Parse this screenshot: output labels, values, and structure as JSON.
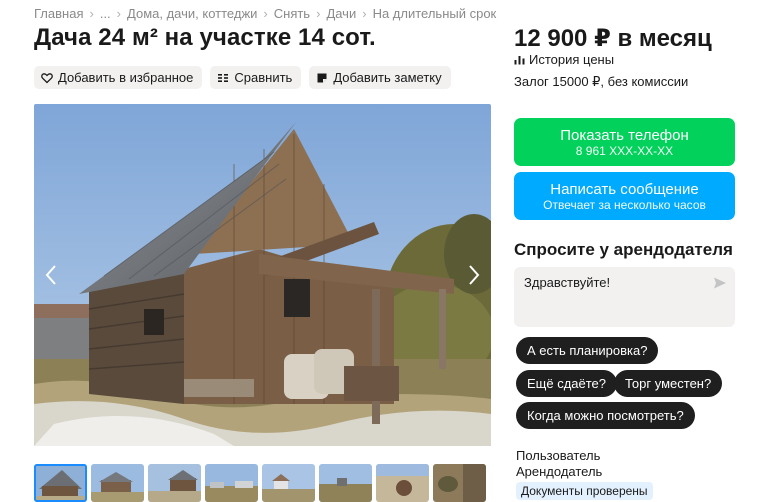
{
  "breadcrumbs": [
    "Главная",
    "...",
    "Дома, дачи, коттеджи",
    "Снять",
    "Дачи",
    "На длительный срок"
  ],
  "title": "Дача 24 м² на участке 14 сот.",
  "actions": {
    "favorite": "Добавить в избранное",
    "compare": "Сравнить",
    "note": "Добавить заметку"
  },
  "price": "12 900 ₽ в месяц",
  "price_history": "История цены",
  "deposit": "Залог 15000 ₽, без комиссии",
  "phone_button": {
    "label": "Показать телефон",
    "sub": "8 961 XXX-XX-XX"
  },
  "message_button": {
    "label": "Написать сообщение",
    "sub": "Отвечает за несколько часов"
  },
  "ask": {
    "title": "Спросите у арендодателя",
    "input_value": "Здравствуйте!",
    "suggestions": [
      "А есть планировка?",
      "Ещё сдаёте?",
      "Торг уместен?",
      "Когда можно посмотреть?"
    ]
  },
  "seller": {
    "name": "Пользователь",
    "role": "Арендодатель",
    "badge": "Документы проверены"
  },
  "colors": {
    "green": "#02d15c",
    "blue": "#00aaff",
    "chip_bg": "#f2f1f0",
    "pill_bg": "#1f1f1f"
  },
  "icons": [
    "heart-icon",
    "compare-icon",
    "note-icon",
    "chart-icon",
    "send-icon",
    "chevron-left-icon",
    "chevron-right-icon"
  ]
}
